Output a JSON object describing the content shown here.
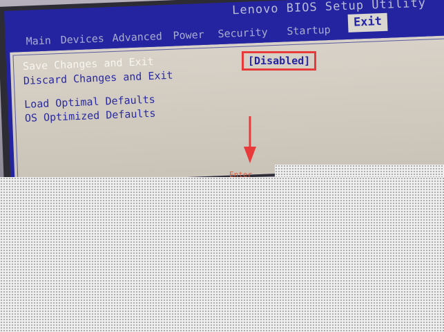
{
  "bios": {
    "title": "Lenovo BIOS Setup Utility",
    "tabs": [
      {
        "label": "Main"
      },
      {
        "label": "Devices"
      },
      {
        "label": "Advanced"
      },
      {
        "label": "Power"
      },
      {
        "label": "Security"
      },
      {
        "label": "Startup"
      },
      {
        "label": "Exit",
        "active": true
      }
    ],
    "menu": {
      "save_changes_and_exit": "Save Changes and Exit",
      "discard_changes_and_exit": "Discard Changes and Exit",
      "load_optimal_defaults": "Load Optimal Defaults",
      "os_optimized_defaults": "OS Optimized Defaults"
    },
    "os_optimized_defaults_value": "[Disabled]"
  },
  "annotation": {
    "highlight_color": "#e83a3a",
    "arrow_color": "#e83a3a",
    "cropped_caption": "Enter"
  },
  "colors": {
    "bios_blue": "#2424a0",
    "panel_gray": "#d8d2c8",
    "selected_text": "#f7f6ef"
  }
}
